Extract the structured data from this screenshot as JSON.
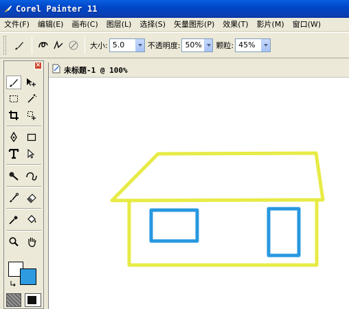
{
  "window": {
    "title": "Corel Painter 11"
  },
  "menu": [
    "文件(F)",
    "编辑(E)",
    "画布(C)",
    "图层(L)",
    "选择(S)",
    "矢量图形(P)",
    "效果(T)",
    "影片(M)",
    "窗口(W)"
  ],
  "property_bar": {
    "size_label": "大小:",
    "size_value": "5.0",
    "opacity_label": "不透明度:",
    "opacity_value": "50%",
    "grain_label": "颗粒:",
    "grain_value": "45%"
  },
  "document": {
    "title": "未标题-1 @ 100%"
  },
  "colors": {
    "main_color": "#ffffff",
    "additional_color": "#2e9be0",
    "house_stroke": "#e6ea3c",
    "window_stroke": "#2898e0"
  }
}
